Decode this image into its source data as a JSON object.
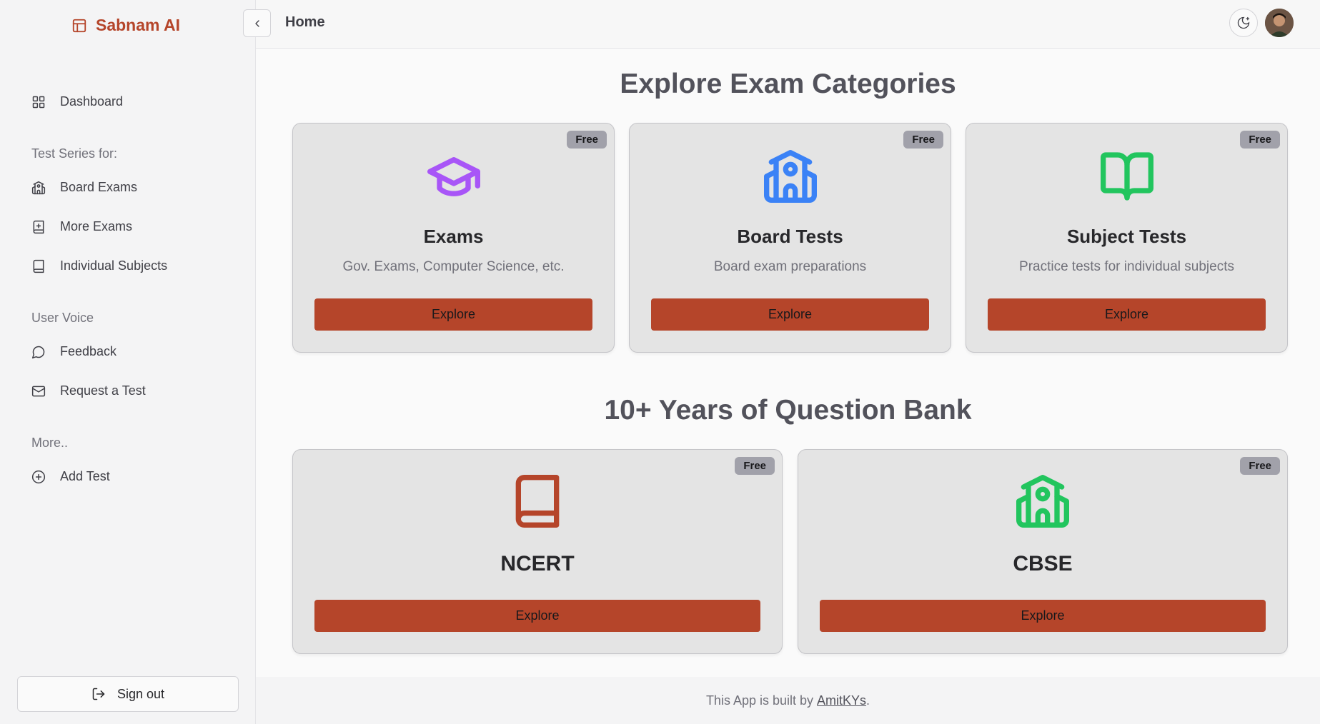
{
  "brand": {
    "name": "Sabnam AI",
    "color": "#b5452a",
    "icon": "layout-icon"
  },
  "sidebar": {
    "dashboard": {
      "label": "Dashboard",
      "icon": "grid-icon"
    },
    "groups": [
      {
        "label": "Test Series for:",
        "items": [
          {
            "label": "Board Exams",
            "icon": "school-icon"
          },
          {
            "label": "More Exams",
            "icon": "book-plus-icon"
          },
          {
            "label": "Individual Subjects",
            "icon": "book-icon"
          }
        ]
      },
      {
        "label": "User Voice",
        "items": [
          {
            "label": "Feedback",
            "icon": "message-circle-icon"
          },
          {
            "label": "Request a Test",
            "icon": "mail-icon"
          }
        ]
      },
      {
        "label": "More..",
        "items": [
          {
            "label": "Add Test",
            "icon": "plus-circle-icon"
          }
        ]
      }
    ],
    "sign_out": "Sign out"
  },
  "header": {
    "breadcrumb": "Home"
  },
  "sections": [
    {
      "title": "Explore Exam Categories",
      "cards": [
        {
          "badge": "Free",
          "title": "Exams",
          "description": "Gov. Exams, Computer Science, etc.",
          "button": "Explore",
          "icon": "graduation-cap-icon",
          "icon_color": "#a855f7"
        },
        {
          "badge": "Free",
          "title": "Board Tests",
          "description": "Board exam preparations",
          "button": "Explore",
          "icon": "school-icon",
          "icon_color": "#3b82f6"
        },
        {
          "badge": "Free",
          "title": "Subject Tests",
          "description": "Practice tests for individual subjects",
          "button": "Explore",
          "icon": "book-open-icon",
          "icon_color": "#22c55e"
        }
      ]
    },
    {
      "title": "10+ Years of Question Bank",
      "cards": [
        {
          "badge": "Free",
          "title": "NCERT",
          "button": "Explore",
          "icon": "book-icon",
          "icon_color": "#b5452a"
        },
        {
          "badge": "Free",
          "title": "CBSE",
          "button": "Explore",
          "icon": "school-icon",
          "icon_color": "#22c55e"
        }
      ]
    }
  ],
  "footer": {
    "text": "This App is built by",
    "author": "AmitKYs",
    "suffix": "."
  },
  "colors": {
    "accent": "#b5452a"
  }
}
